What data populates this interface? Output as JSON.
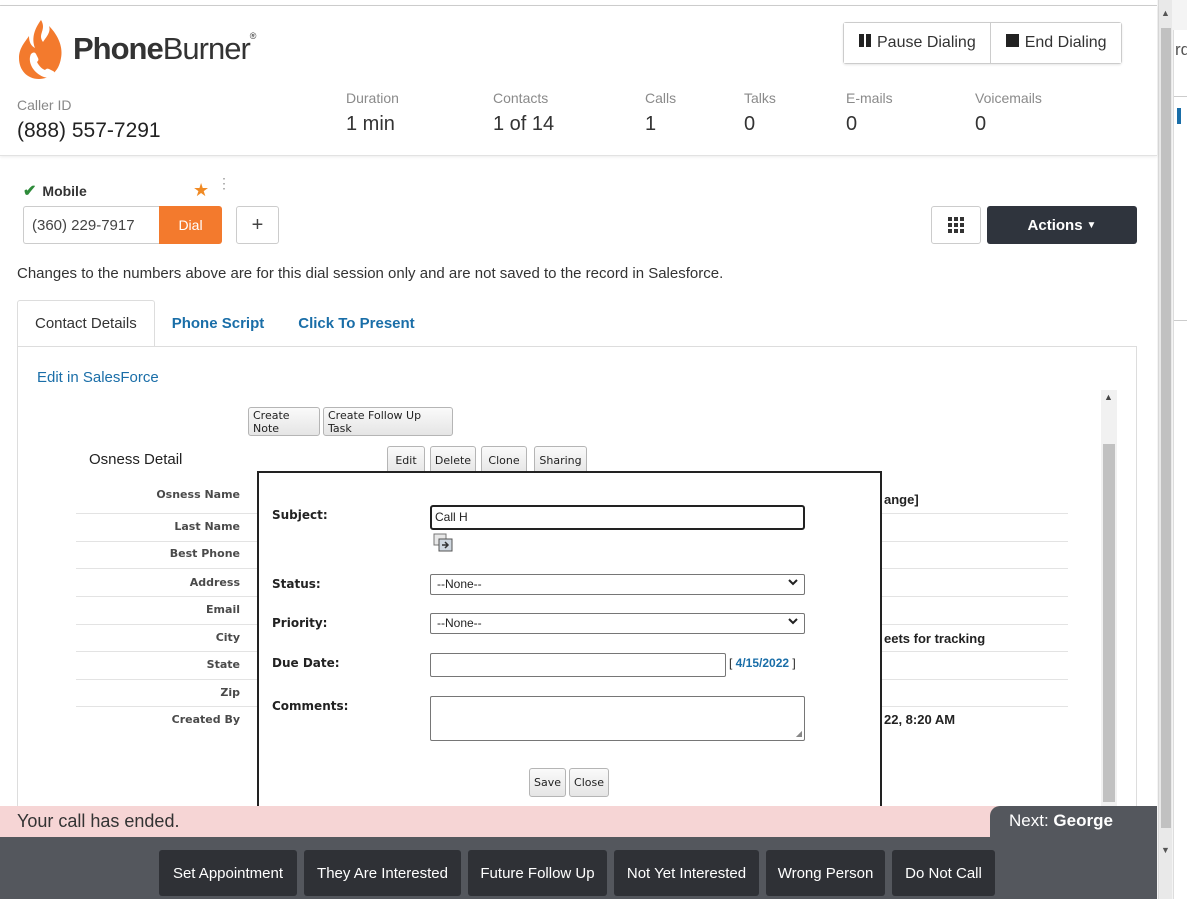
{
  "brand": {
    "name_bold": "Phone",
    "name_light": "Burner",
    "reg": "®",
    "color": "#f37a2d"
  },
  "caller": {
    "label": "Caller ID",
    "value": "(888) 557-7291"
  },
  "stats": [
    {
      "label": "Duration",
      "value": "1 min"
    },
    {
      "label": "Contacts",
      "value": "1 of 14"
    },
    {
      "label": "Calls",
      "value": "1"
    },
    {
      "label": "Talks",
      "value": "0"
    },
    {
      "label": "E-mails",
      "value": "0"
    },
    {
      "label": "Voicemails",
      "value": "0"
    }
  ],
  "dialing": {
    "pause": "Pause Dialing",
    "end": "End Dialing"
  },
  "phone": {
    "type": "Mobile",
    "number": "(360) 229-7917",
    "dial": "Dial",
    "add": "+",
    "actions": "Actions"
  },
  "notice": "Changes to the numbers above are for this dial session only and are not saved to the record in Salesforce.",
  "tabs": [
    "Contact Details",
    "Phone Script",
    "Click To Present"
  ],
  "edit_link": "Edit in SalesForce",
  "record": {
    "create_note": "Create Note",
    "create_task": "Create Follow Up Task",
    "title": "Osness Detail",
    "edit": "Edit",
    "delete": "Delete",
    "clone": "Clone",
    "sharing": "Sharing",
    "fields": [
      "Osness Name",
      "Last Name",
      "Best Phone",
      "Address",
      "Email",
      "City",
      "State",
      "Zip",
      "Created By"
    ],
    "partial_values": [
      "ange]",
      "eets for tracking",
      "22, 8:20 AM"
    ]
  },
  "task_form": {
    "subject_label": "Subject:",
    "subject_value": "Call H",
    "status_label": "Status:",
    "status_value": "--None--",
    "priority_label": "Priority:",
    "priority_value": "--None--",
    "due_label": "Due Date:",
    "due_today": "4/15/2022",
    "comments_label": "Comments:",
    "save": "Save",
    "close": "Close"
  },
  "status_bar": {
    "ended": "Your call has ended.",
    "next_label": "Next:",
    "next_name": "George"
  },
  "dispositions": [
    "Set Appointment",
    "They Are Interested",
    "Future Follow Up",
    "Not Yet Interested",
    "Wrong Person",
    "Do Not Call"
  ],
  "browser_peek": {
    "text": "rdi"
  }
}
